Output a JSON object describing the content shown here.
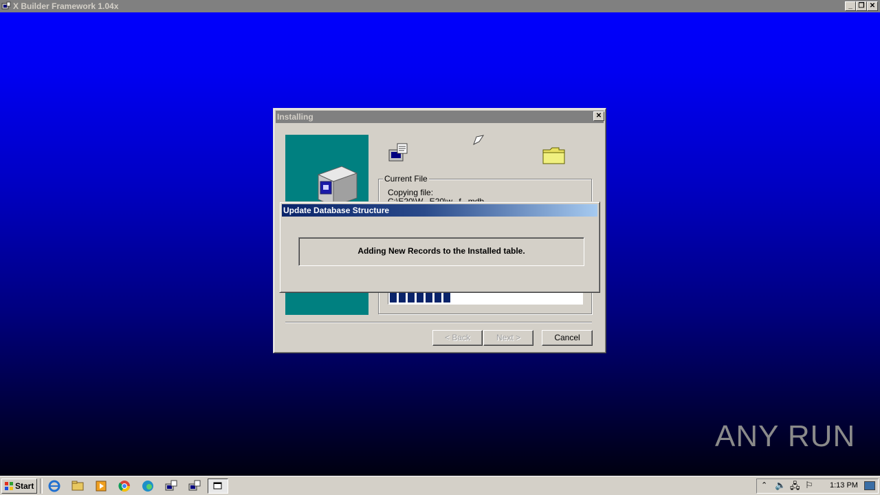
{
  "app": {
    "title": "X Builder Framework 1.04x"
  },
  "installer": {
    "title": "Installing",
    "current_file_label": "Current File",
    "copying_label": "Copying file:",
    "copying_path": "C:\\E20\\W...E20\\w...f...mdb",
    "progress_fraction": 0.35,
    "buttons": {
      "back": "< Back",
      "next": "Next >",
      "cancel": "Cancel"
    }
  },
  "dialog": {
    "title": "Update Database Structure",
    "message": "Adding New Records to the Installed table."
  },
  "taskbar": {
    "start_label": "Start",
    "clock": "1:13 PM"
  },
  "watermark": {
    "text": "ANY RUN"
  },
  "colors": {
    "desktop": "#0000ff",
    "teal_panel": "#008080",
    "progress": "#0a246a",
    "title_active_start": "#0a246a",
    "title_active_end": "#a6caf0"
  }
}
